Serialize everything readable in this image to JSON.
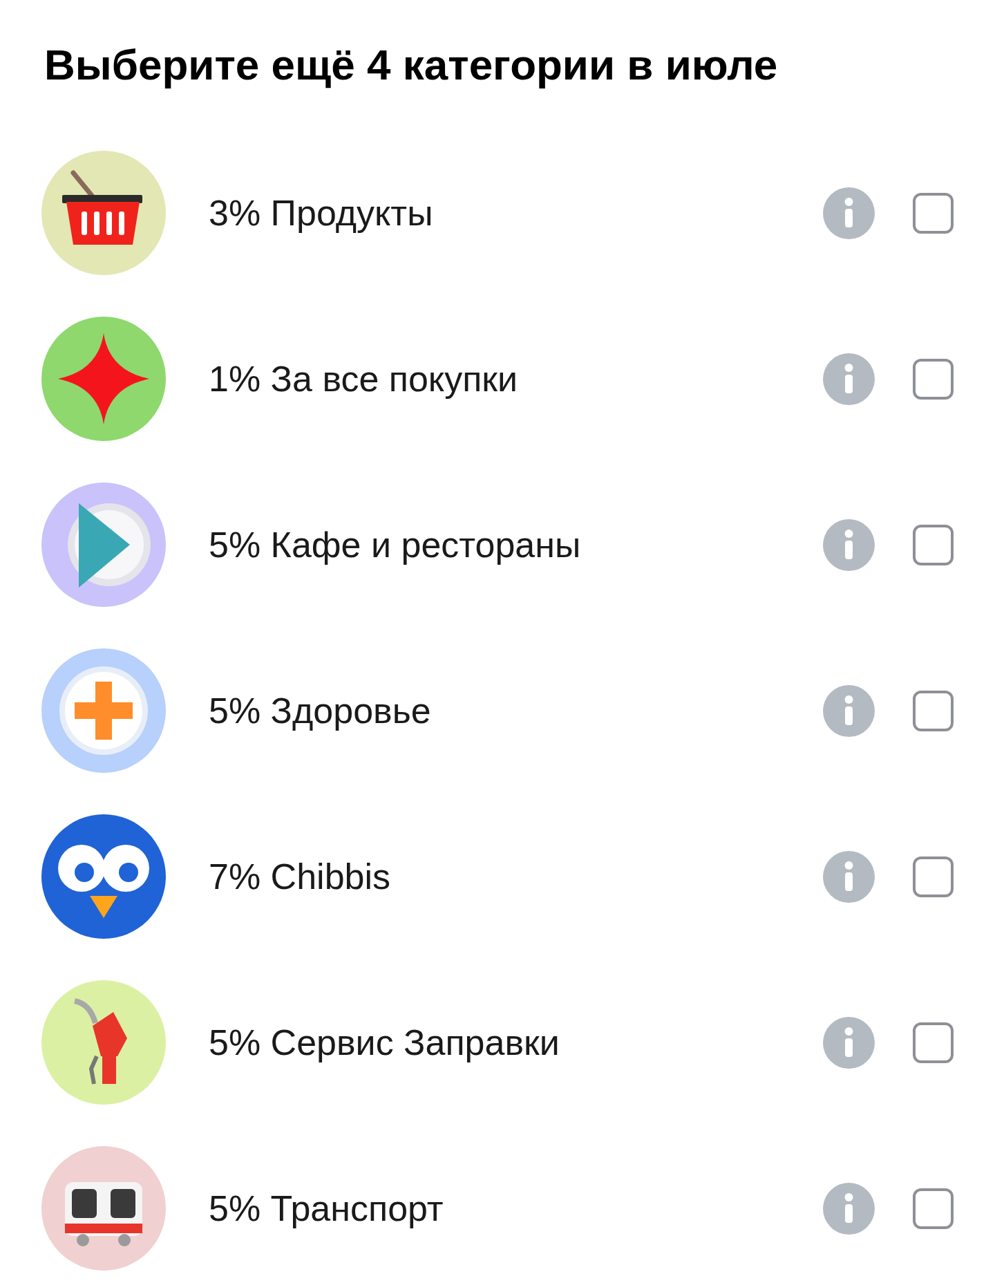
{
  "title": "Выберите ещё 4 категории в июле",
  "categories": [
    {
      "label": "3% Продукты",
      "checked": false
    },
    {
      "label": "1% За все покупки",
      "checked": false
    },
    {
      "label": "5% Кафе и рестораны",
      "checked": false
    },
    {
      "label": "5% Здоровье",
      "checked": false
    },
    {
      "label": "7% Chibbis",
      "checked": false
    },
    {
      "label": "5% Сервис Заправки",
      "checked": false
    },
    {
      "label": "5% Транспорт",
      "checked": false
    }
  ]
}
